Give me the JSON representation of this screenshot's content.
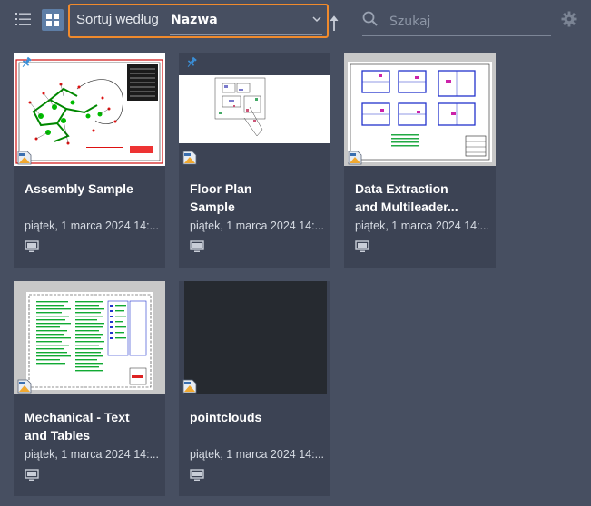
{
  "toolbar": {
    "list_view_icon": "list-icon",
    "grid_view_icon": "grid-icon",
    "sort_label": "Sortuj według",
    "sort_value": "Nazwa",
    "sort_direction_icon": "arrow-up-icon",
    "search_placeholder": "Szukaj",
    "settings_icon": "gear-icon",
    "accent_color": "#f08a2c"
  },
  "cards": [
    {
      "title": "Assembly Sample",
      "date": "piątek, 1 marca 2024 14:...",
      "pinned": true
    },
    {
      "title": "Floor Plan\nSample",
      "date": "piątek, 1 marca 2024 14:...",
      "pinned": true
    },
    {
      "title": "Data Extraction\nand Multileader...",
      "date": "piątek, 1 marca 2024 14:...",
      "pinned": false
    },
    {
      "title": "Mechanical - Text\nand Tables",
      "date": "piątek, 1 marca 2024 14:...",
      "pinned": false
    },
    {
      "title": "pointclouds",
      "date": "piątek, 1 marca 2024 14:...",
      "pinned": false
    }
  ]
}
